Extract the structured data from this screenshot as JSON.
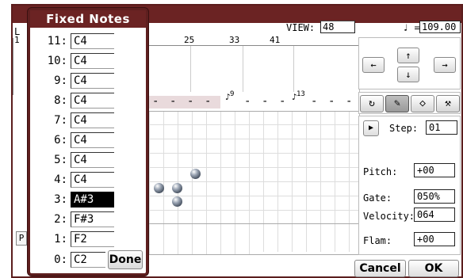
{
  "background_window": {
    "left_label": "L",
    "view_label": "VIEW:",
    "view_value": "48",
    "tempo_symbol": "♩ =",
    "tempo_value": "109.00",
    "ruler_ticks": [
      "1",
      "25",
      "33",
      "41"
    ],
    "rhythm_numbers": [
      "9",
      "13"
    ],
    "step_label": "Step:",
    "step_value": "01",
    "params": [
      {
        "label": "Pitch:",
        "value": "+00"
      },
      {
        "label": "Gate:",
        "value": "050%"
      },
      {
        "label": "Velocity:",
        "value": "064"
      },
      {
        "label": "Flam:",
        "value": "+00"
      }
    ],
    "p_stub": "P",
    "cancel_label": "Cancel",
    "ok_label": "OK"
  },
  "fixed_notes_popup": {
    "title": "Fixed Notes",
    "rows": [
      {
        "index": "11:",
        "note": "C4",
        "selected": false
      },
      {
        "index": "10:",
        "note": "C4",
        "selected": false
      },
      {
        "index": "9:",
        "note": "C4",
        "selected": false
      },
      {
        "index": "8:",
        "note": "C4",
        "selected": false
      },
      {
        "index": "7:",
        "note": "C4",
        "selected": false
      },
      {
        "index": "6:",
        "note": "C4",
        "selected": false
      },
      {
        "index": "5:",
        "note": "C4",
        "selected": false
      },
      {
        "index": "4:",
        "note": "C4",
        "selected": false
      },
      {
        "index": "3:",
        "note": "A#3",
        "selected": true
      },
      {
        "index": "2:",
        "note": "F#3",
        "selected": false
      },
      {
        "index": "1:",
        "note": "F2",
        "selected": false
      },
      {
        "index": "0:",
        "note": "C2",
        "selected": false
      }
    ],
    "done_label": "Done"
  },
  "colors": {
    "title_bar": "#6b2323",
    "popup_border": "#5e1f1f",
    "rhythm_shade": "#e9dadc",
    "selected_field_bg": "#000000"
  },
  "icons": [
    "arrow-left-icon",
    "arrow-up-icon",
    "arrow-down-icon",
    "arrow-right-icon",
    "loop-icon",
    "pencil-icon",
    "eraser-icon",
    "wrench-icon",
    "play-icon",
    "note-icon"
  ]
}
